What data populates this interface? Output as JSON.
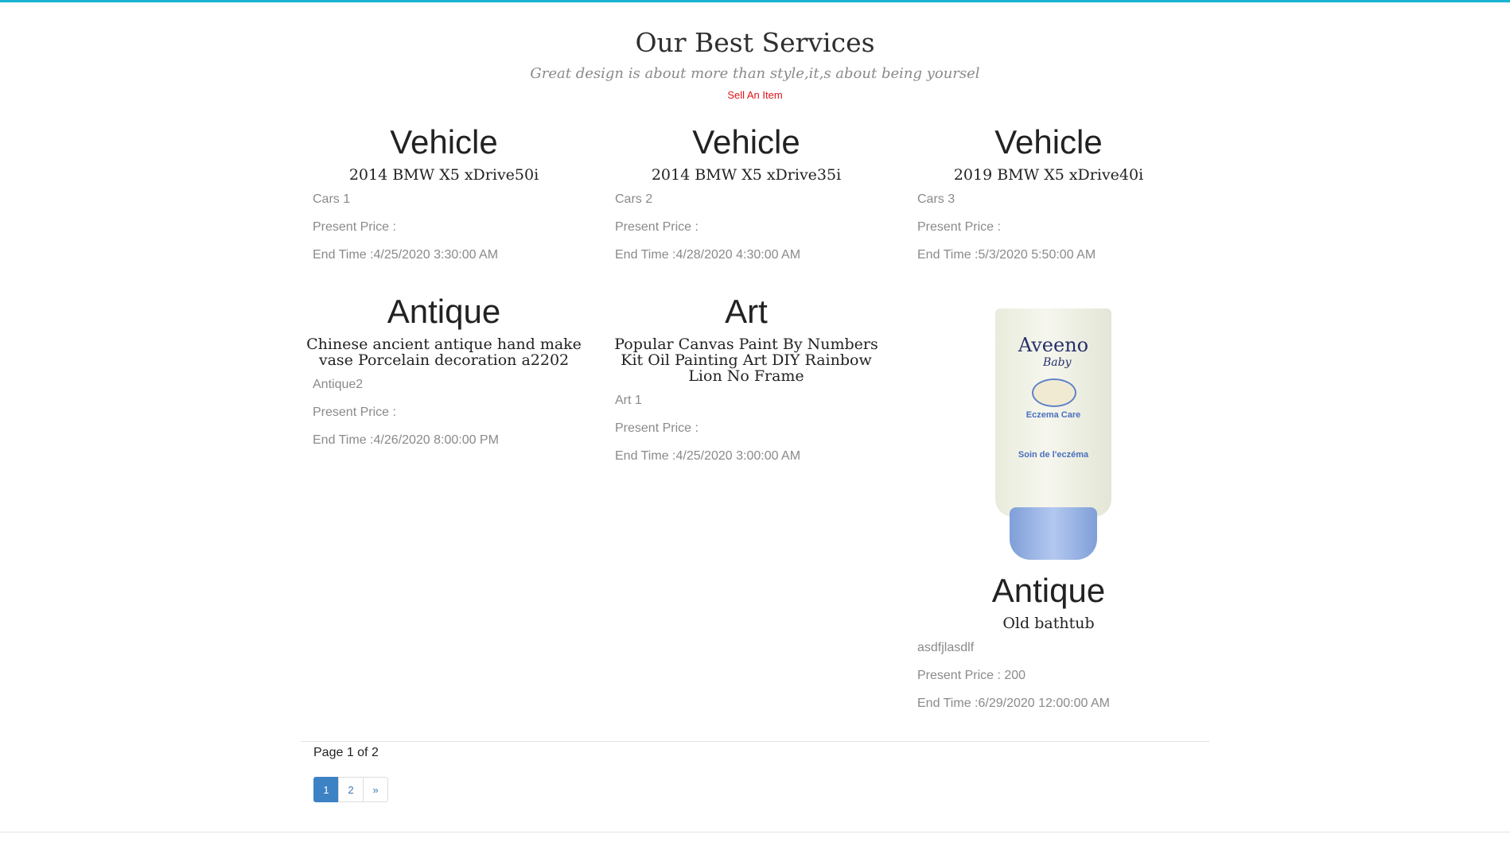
{
  "header": {
    "title": "Our Best Services",
    "subtitle": "Great design is about more than style,it,s about being yoursel",
    "sell_link": "Sell An Item"
  },
  "cards": [
    {
      "category": "Vehicle",
      "title": "2014 BMW X5 xDrive50i",
      "description": "Cars 1",
      "price": "Present Price :",
      "end_time": "End Time :4/25/2020 3:30:00 AM"
    },
    {
      "category": "Vehicle",
      "title": "2014 BMW X5 xDrive35i",
      "description": "Cars 2",
      "price": "Present Price :",
      "end_time": "End Time :4/28/2020 4:30:00 AM"
    },
    {
      "category": "Vehicle",
      "title": "2019 BMW X5 xDrive40i",
      "description": "Cars 3",
      "price": "Present Price :",
      "end_time": "End Time :5/3/2020 5:50:00 AM"
    },
    {
      "category": "Antique",
      "title": "Chinese ancient antique hand make vase Porcelain decoration a2202",
      "description": "Antique2",
      "price": "Present Price :",
      "end_time": "End Time :4/26/2020 8:00:00 PM"
    },
    {
      "category": "Art",
      "title": "Popular Canvas Paint By Numbers Kit Oil Painting Art DIY Rainbow Lion No Frame",
      "description": "Art 1",
      "price": "Present Price :",
      "end_time": "End Time :4/25/2020 3:00:00 AM"
    },
    {
      "category": "Antique",
      "title": "Old bathtub",
      "description": "asdfjlasdlf",
      "price": "Present Price : 200",
      "end_time": "End Time :6/29/2020 12:00:00 AM",
      "image": {
        "brand": "Aveeno",
        "sub": "Baby",
        "text1": "Eczema Care",
        "text2": "Soin de l'eczéma"
      }
    }
  ],
  "pagination": {
    "info": "Page 1 of 2",
    "pages": [
      "1",
      "2"
    ],
    "next": "»",
    "active": "1"
  },
  "colors": {
    "accent": "#19b3d3",
    "link_red": "#e0141b",
    "page_active": "#3d82c4"
  }
}
